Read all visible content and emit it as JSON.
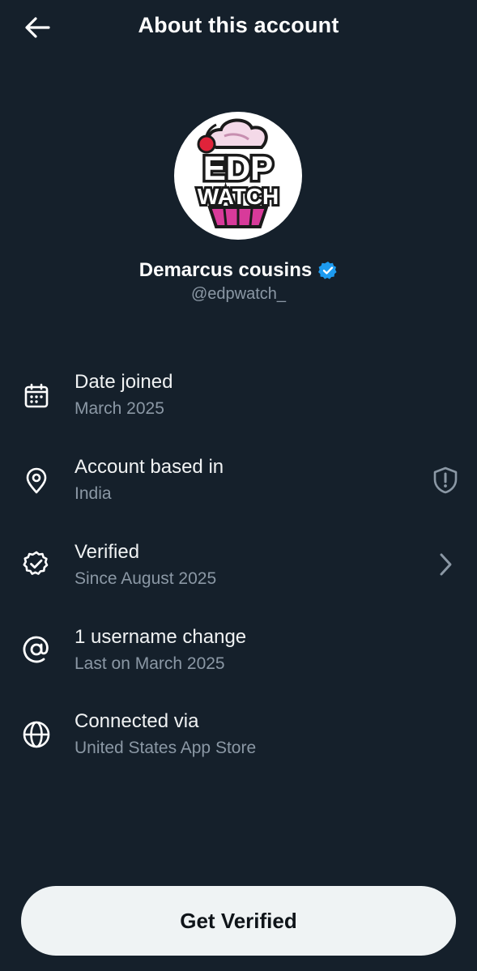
{
  "header": {
    "title": "About this account",
    "back_icon": "arrow-left-icon"
  },
  "profile": {
    "display_name": "Demarcus cousins",
    "handle": "@edpwatch_",
    "verified": true,
    "badge_color": "#1d9bf0",
    "avatar_logo_text": "EDP WATCH"
  },
  "info": {
    "rows": [
      {
        "icon": "calendar-icon",
        "title": "Date joined",
        "subtitle": "March 2025"
      },
      {
        "icon": "location-pin-icon",
        "title": "Account based in",
        "subtitle": "India",
        "trailing_icon": "shield-alert-icon"
      },
      {
        "icon": "verified-check-icon",
        "title": "Verified",
        "subtitle": "Since August 2025",
        "trailing_icon": "chevron-right-icon"
      },
      {
        "icon": "at-sign-icon",
        "title": "1 username change",
        "subtitle": "Last on March 2025"
      },
      {
        "icon": "globe-icon",
        "title": "Connected via",
        "subtitle": "United States App Store"
      }
    ]
  },
  "cta": {
    "label": "Get Verified"
  },
  "colors": {
    "background": "#15202b",
    "primary_text": "#e7e9ea",
    "secondary_text": "#8b98a5",
    "button_bg": "#eff3f4",
    "button_text": "#0f1419"
  }
}
